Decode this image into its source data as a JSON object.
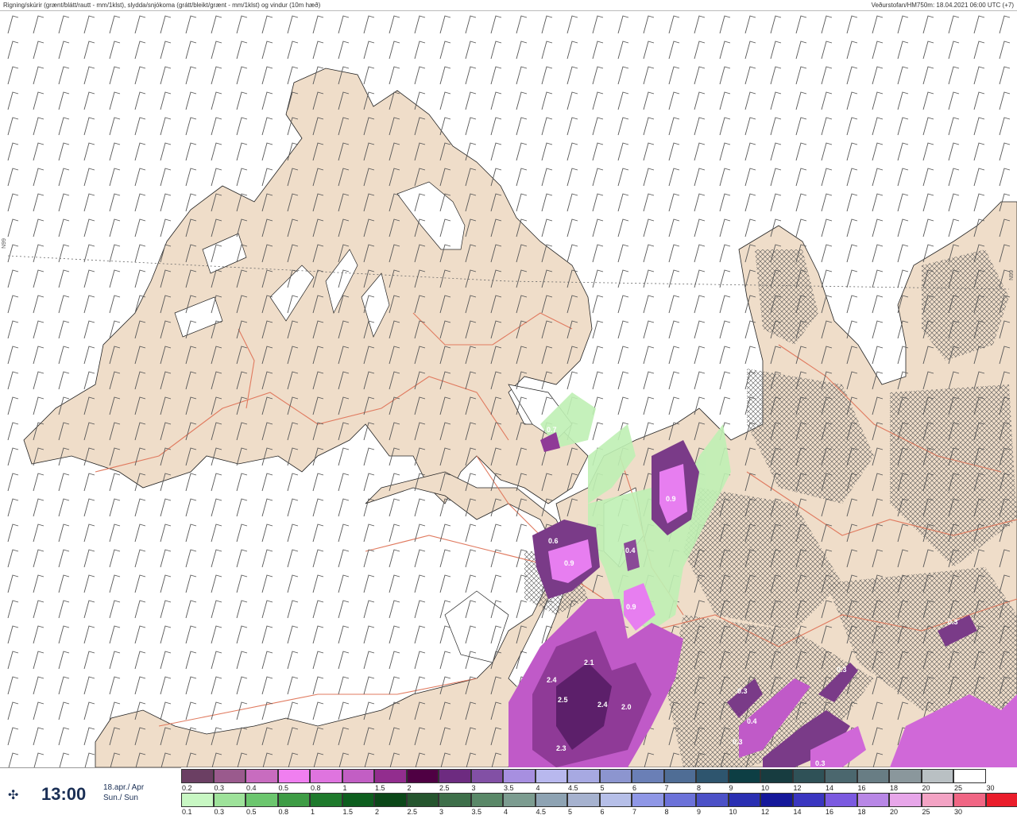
{
  "header": {
    "left_title": "Rigning/skúrir (grænt/blátt/rautt - mm/1klst), slydda/snjókoma (grátt/bleikt/grænt - mm/1klst) og vindur (10m hæð)",
    "right_title": "Veðurstofan/HM750m: 18.04.2021 06:00 UTC (+7)"
  },
  "map": {
    "lat_label_left": "N99",
    "lat_label_right": "N99",
    "value_labels": [
      "0.7",
      "0.6",
      "0.9",
      "0.4",
      "0.9",
      "0.9",
      "0.3",
      "2.1",
      "2.4",
      "2.5",
      "2.4",
      "2.0",
      "2.3",
      "0.3",
      "0.4",
      "0.3",
      "0.3",
      "0.3",
      "0.6"
    ]
  },
  "footer": {
    "time": "13:00",
    "date_line1": "18.apr./ Apr",
    "date_line2": "Sun./ Sun"
  },
  "legend": {
    "snow_colors": [
      "#6b3f63",
      "#9a5a8d",
      "#c86cbf",
      "#f07ff0",
      "#df74df",
      "#c25ec4",
      "#922d8e",
      "#4f0043",
      "#6d2b80",
      "#8250a5",
      "#a78fe0",
      "#b8b8ee",
      "#a7a9e2",
      "#8c95cf",
      "#6a7fb6",
      "#4f6d95",
      "#2e556e",
      "#0d3e44",
      "#173c40",
      "#2f5157",
      "#4b676e",
      "#687d84",
      "#8a979c",
      "#b9c0c3",
      "#ffffff"
    ],
    "snow_labels": [
      "0.2",
      "0.3",
      "0.4",
      "0.5",
      "0.8",
      "1",
      "1.5",
      "2",
      "2.5",
      "3",
      "3.5",
      "4",
      "4.5",
      "5",
      "6",
      "7",
      "8",
      "9",
      "10",
      "12",
      "14",
      "16",
      "18",
      "20",
      "25",
      "30"
    ],
    "rain_colors": [
      "#c8f7c3",
      "#9ee29a",
      "#6cc66e",
      "#3e9c45",
      "#1e7a2c",
      "#0d5e1e",
      "#0b4718",
      "#25552e",
      "#3e6f4a",
      "#5a8868",
      "#7c9c90",
      "#8ea3b3",
      "#a6b2cf",
      "#b6bfe8",
      "#8f97e6",
      "#6c72d9",
      "#4c51c7",
      "#2a2fb2",
      "#15189a",
      "#3a36c0",
      "#7b5ae0",
      "#b887e6",
      "#e7a6e9",
      "#f3a3c4",
      "#f06684",
      "#ea1d2b"
    ],
    "rain_labels": [
      "0.1",
      "0.3",
      "0.5",
      "0.8",
      "1",
      "1.5",
      "2",
      "2.5",
      "3",
      "3.5",
      "4",
      "4.5",
      "5",
      "6",
      "7",
      "8",
      "9",
      "10",
      "12",
      "14",
      "16",
      "18",
      "20",
      "25",
      "30"
    ]
  }
}
